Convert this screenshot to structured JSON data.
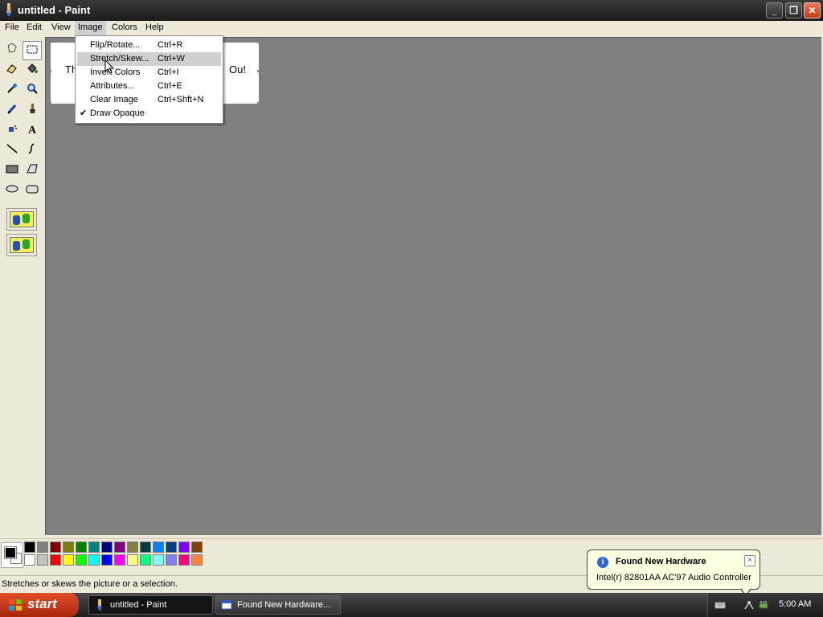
{
  "window": {
    "title": "untitled - Paint"
  },
  "menubar": [
    {
      "label": "File"
    },
    {
      "label": "Edit"
    },
    {
      "label": "View"
    },
    {
      "label": "Image"
    },
    {
      "label": "Colors"
    },
    {
      "label": "Help"
    }
  ],
  "image_menu": {
    "items": [
      {
        "label": "Flip/Rotate...",
        "shortcut": "Ctrl+R"
      },
      {
        "label": "Stretch/Skew...",
        "shortcut": "Ctrl+W",
        "highlighted": true
      },
      {
        "label": "Invert Colors",
        "shortcut": "Ctrl+I"
      },
      {
        "label": "Attributes...",
        "shortcut": "Ctrl+E"
      },
      {
        "label": "Clear Image",
        "shortcut": "Ctrl+Shft+N"
      },
      {
        "label": "Draw Opaque",
        "checked": true
      }
    ]
  },
  "canvas": {
    "text_left": "Th",
    "text_right": "Ou!"
  },
  "status": {
    "text": "Stretches or skews the picture or a selection."
  },
  "palette": {
    "top_row": [
      "#000000",
      "#808080",
      "#800000",
      "#808000",
      "#008000",
      "#008080",
      "#000080",
      "#800080",
      "#808040",
      "#004040",
      "#0080ff",
      "#004080",
      "#8000ff",
      "#804000"
    ],
    "bottom_row": [
      "#ffffff",
      "#c0c0c0",
      "#ff0000",
      "#ffff00",
      "#00ff00",
      "#00ffff",
      "#0000ff",
      "#ff00ff",
      "#ffff80",
      "#00ff80",
      "#80ffff",
      "#8080ff",
      "#ff0080",
      "#ff8040"
    ]
  },
  "balloon": {
    "title": "Found New Hardware",
    "text": "Intel(r) 82801AA AC'97 Audio Controller",
    "close_symbol": "×",
    "info_symbol": "i"
  },
  "taskbar": {
    "start_label": "start",
    "tasks": [
      {
        "label": "untitled - Paint"
      },
      {
        "label": "Found New Hardware..."
      }
    ],
    "clock": "5:00 AM"
  }
}
